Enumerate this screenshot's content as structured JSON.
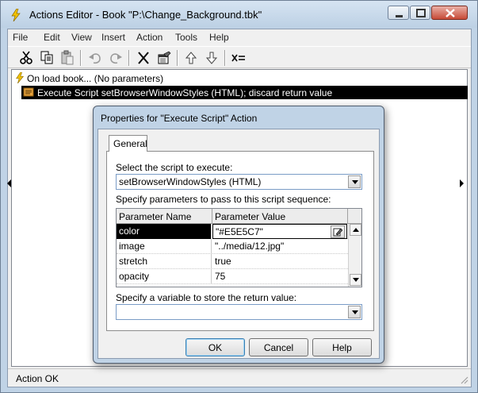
{
  "window": {
    "title": "Actions Editor - Book \"P:\\Change_Background.tbk\""
  },
  "menu": [
    "File",
    "Edit",
    "View",
    "Insert",
    "Action",
    "Tools",
    "Help"
  ],
  "toolbar": {
    "buttons": [
      "cut-icon",
      "copy-icon",
      "paste-icon",
      "undo-icon",
      "redo-icon",
      "delete-icon",
      "properties-icon",
      "move-up-icon",
      "move-down-icon",
      "variable-icon"
    ]
  },
  "tree": {
    "items": [
      {
        "text": "On load book... (No parameters)",
        "icon": "lightning-icon",
        "selected": false
      },
      {
        "text": "Execute Script setBrowserWindowStyles (HTML); discard return value",
        "icon": "script-icon",
        "selected": true
      }
    ]
  },
  "status": {
    "text": "Action OK"
  },
  "dialog": {
    "title": "Properties for \"Execute Script\" Action",
    "tab": "General",
    "script_label": "Select the script to execute:",
    "script_value": "setBrowserWindowStyles (HTML)",
    "params_label": "Specify parameters to pass to this script sequence:",
    "grid": {
      "headers": [
        "Parameter Name",
        "Parameter Value"
      ],
      "rows": [
        {
          "name": "color",
          "value": "\"#E5E5C7\""
        },
        {
          "name": "image",
          "value": "\"../media/12.jpg\""
        },
        {
          "name": "stretch",
          "value": "true"
        },
        {
          "name": "opacity",
          "value": "75"
        }
      ]
    },
    "return_label": "Specify a variable to store the return value:",
    "return_value": "",
    "buttons": {
      "ok": "OK",
      "cancel": "Cancel",
      "help": "Help"
    }
  }
}
